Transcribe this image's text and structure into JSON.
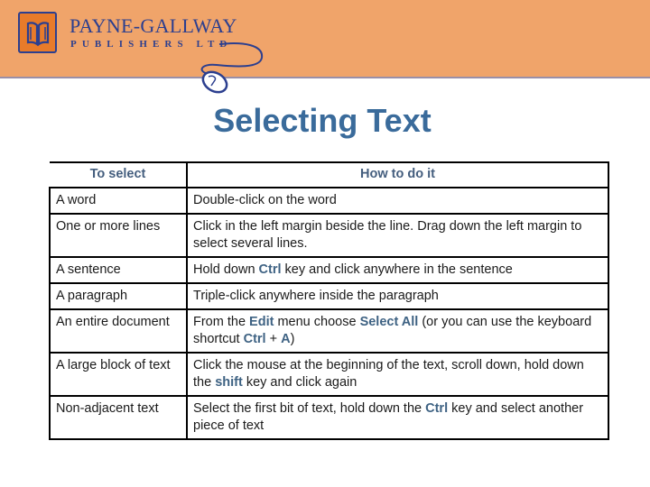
{
  "brand": {
    "name": "PAYNE-GALLWAY",
    "subtitle": "PUBLISHERS LTD",
    "logo_icon": "open-book-icon",
    "mouse_icon": "computer-mouse-icon"
  },
  "colors": {
    "banner": "#f0a46a",
    "brand_text": "#2c3f8f",
    "title": "#3a6b9b",
    "keyword": "#3e6283",
    "header_text": "#445e7e"
  },
  "title": "Selecting Text",
  "table": {
    "headers": [
      "To select",
      "How to do it"
    ],
    "rows": [
      {
        "target": "A word",
        "how": [
          {
            "t": "Double-click on the word"
          }
        ]
      },
      {
        "target": "One or more lines",
        "how": [
          {
            "t": "Click in the left margin beside the line.  Drag down the left margin to select several lines."
          }
        ]
      },
      {
        "target": "A sentence",
        "how": [
          {
            "t": "Hold down "
          },
          {
            "t": "Ctrl",
            "k": true
          },
          {
            "t": " key and click anywhere in the sentence"
          }
        ]
      },
      {
        "target": "A paragraph",
        "how": [
          {
            "t": "Triple-click anywhere inside the paragraph"
          }
        ]
      },
      {
        "target": "An entire document",
        "how": [
          {
            "t": "From the "
          },
          {
            "t": "Edit",
            "k": true
          },
          {
            "t": " menu choose "
          },
          {
            "t": "Select All",
            "k": true
          },
          {
            "t": " (or you can use the keyboard shortcut "
          },
          {
            "t": "Ctrl",
            "k": true
          },
          {
            "t": " + "
          },
          {
            "t": "A",
            "k": true
          },
          {
            "t": ")"
          }
        ]
      },
      {
        "target": "A large block of text",
        "how": [
          {
            "t": "Click the mouse at the beginning of the text, scroll down, hold down the "
          },
          {
            "t": "shift",
            "k": true
          },
          {
            "t": " key and click again"
          }
        ]
      },
      {
        "target": "Non-adjacent text",
        "how": [
          {
            "t": "Select the first bit of text, hold down the "
          },
          {
            "t": "Ctrl",
            "k": true
          },
          {
            "t": " key and select another piece of text"
          }
        ]
      }
    ]
  }
}
